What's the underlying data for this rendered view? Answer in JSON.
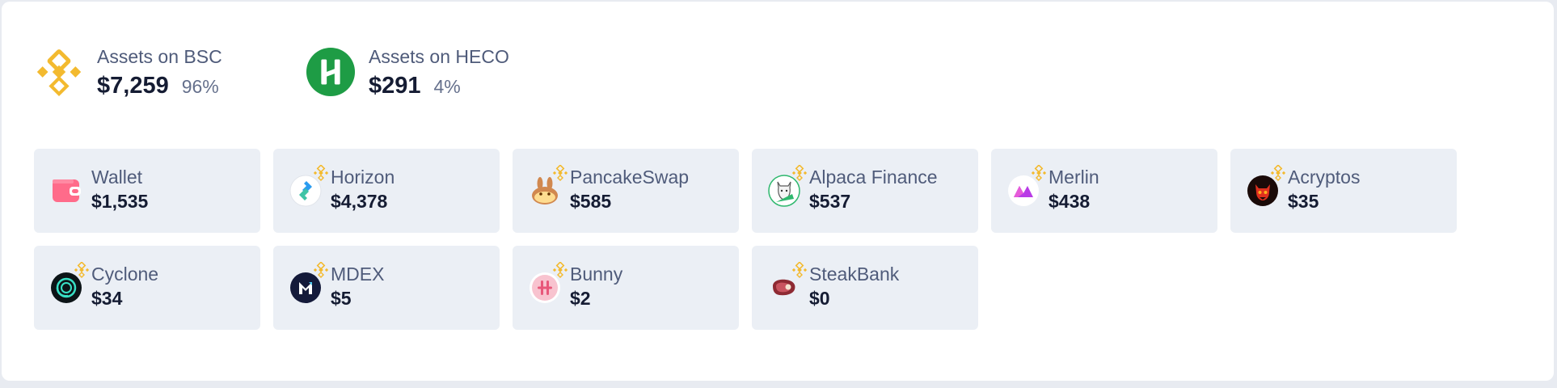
{
  "chains": [
    {
      "label": "Assets on BSC",
      "amount": "$7,259",
      "percent": "96%"
    },
    {
      "label": "Assets on HECO",
      "amount": "$291",
      "percent": "4%"
    }
  ],
  "colors": {
    "bsc": "#F3BA2F",
    "heco": "#1E9C45",
    "card_bg": "#EBEFF5"
  },
  "protocols": [
    {
      "name": "Wallet",
      "value": "$1,535",
      "icon": "wallet-icon"
    },
    {
      "name": "Horizon",
      "value": "$4,378",
      "icon": "horizon-icon"
    },
    {
      "name": "PancakeSwap",
      "value": "$585",
      "icon": "pancakeswap-icon"
    },
    {
      "name": "Alpaca Finance",
      "value": "$537",
      "icon": "alpaca-finance-icon"
    },
    {
      "name": "Merlin",
      "value": "$438",
      "icon": "merlin-icon"
    },
    {
      "name": "Acryptos",
      "value": "$35",
      "icon": "acryptos-icon"
    },
    {
      "name": "Cyclone",
      "value": "$34",
      "icon": "cyclone-icon"
    },
    {
      "name": "MDEX",
      "value": "$5",
      "icon": "mdex-icon"
    },
    {
      "name": "Bunny",
      "value": "$2",
      "icon": "bunny-icon"
    },
    {
      "name": "SteakBank",
      "value": "$0",
      "icon": "steakbank-icon"
    }
  ]
}
